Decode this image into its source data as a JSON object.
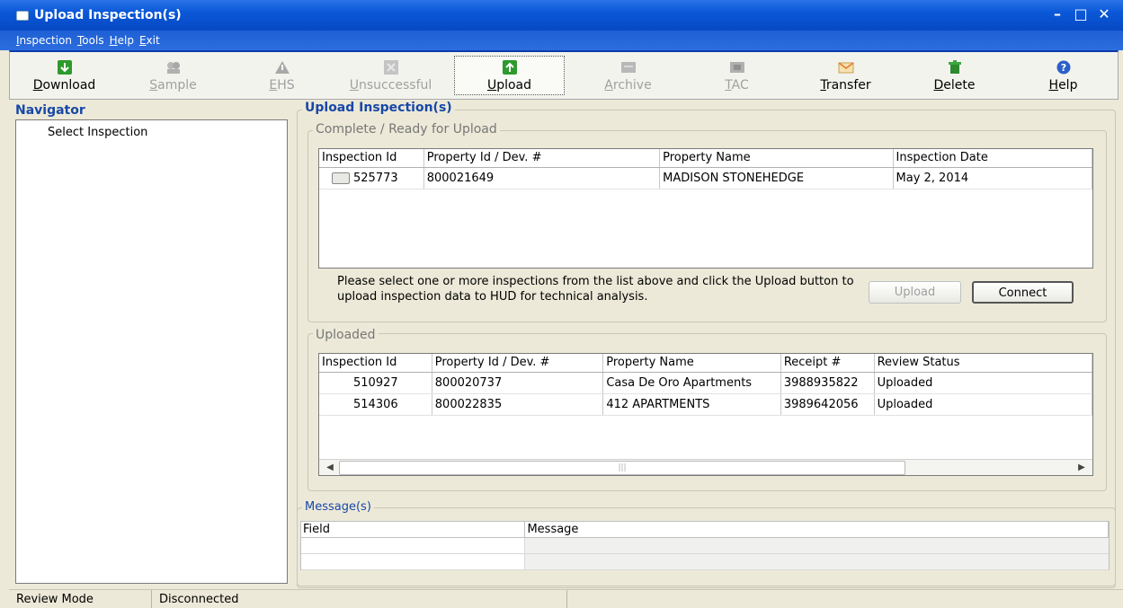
{
  "window": {
    "title": "Upload Inspection(s)"
  },
  "menu": [
    "Inspection",
    "Tools",
    "Help",
    "Exit"
  ],
  "toolbar": [
    {
      "label": "Download",
      "icon": "download-icon",
      "enabled": true
    },
    {
      "label": "Sample",
      "icon": "sample-icon",
      "enabled": false
    },
    {
      "label": "EHS",
      "icon": "warning-icon",
      "enabled": false
    },
    {
      "label": "Unsuccessful",
      "icon": "unsuccessful-icon",
      "enabled": false
    },
    {
      "label": "Upload",
      "icon": "upload-icon",
      "enabled": true,
      "selected": true
    },
    {
      "label": "Archive",
      "icon": "archive-icon",
      "enabled": false
    },
    {
      "label": "TAC",
      "icon": "tac-icon",
      "enabled": false
    },
    {
      "label": "Transfer",
      "icon": "transfer-icon",
      "enabled": true
    },
    {
      "label": "Delete",
      "icon": "delete-icon",
      "enabled": true
    },
    {
      "label": "Help",
      "icon": "help-icon",
      "enabled": true
    }
  ],
  "navigator": {
    "title": "Navigator",
    "item": "Select Inspection"
  },
  "main": {
    "title": "Upload Inspection(s)",
    "ready": {
      "title": "Complete / Ready for Upload",
      "columns": [
        "Inspection Id",
        "Property Id / Dev. #",
        "Property Name",
        "Inspection Date"
      ],
      "rows": [
        [
          "525773",
          "800021649",
          "MADISON STONEHEDGE",
          "May 2, 2014"
        ]
      ],
      "instructions": "Please select one or more inspections from the list above and click the Upload button to upload inspection data to HUD for technical analysis.",
      "upload_label": "Upload",
      "connect_label": "Connect"
    },
    "uploaded": {
      "title": "Uploaded",
      "columns": [
        "Inspection Id",
        "Property Id / Dev. #",
        "Property Name",
        "Receipt #",
        "Review Status"
      ],
      "rows": [
        [
          "510927",
          "800020737",
          "Casa De Oro Apartments",
          "3988935822",
          "Uploaded"
        ],
        [
          "514306",
          "800022835",
          "412  APARTMENTS",
          "3989642056",
          "Uploaded"
        ]
      ]
    },
    "messages": {
      "title": "Message(s)",
      "columns": [
        "Field",
        "Message"
      ]
    }
  },
  "status": {
    "mode": "Review Mode",
    "connection": "Disconnected"
  },
  "colors": {
    "titlebar": "#0a58d8",
    "accent": "#1848a8",
    "panel": "#ece9d8"
  }
}
